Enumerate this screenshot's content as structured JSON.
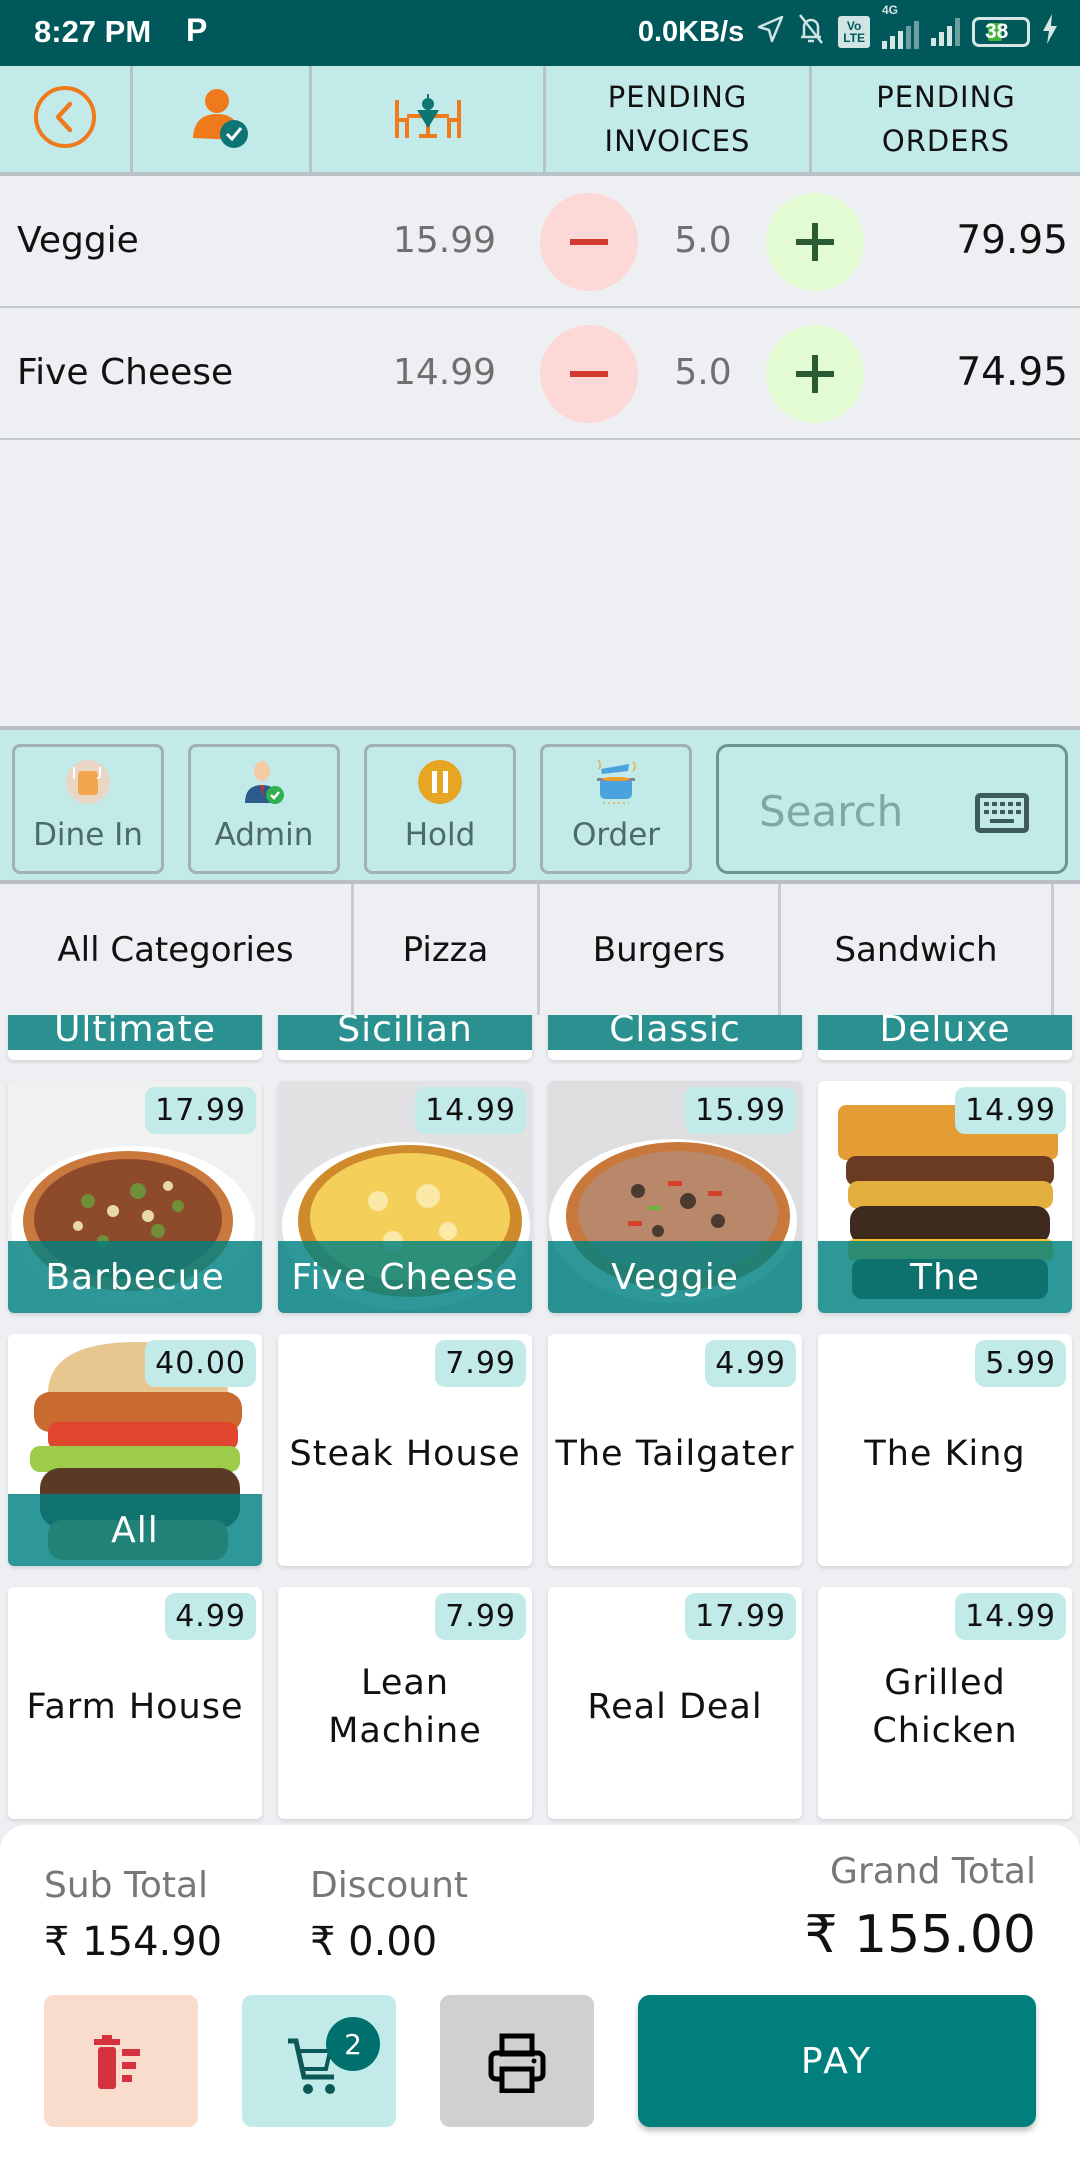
{
  "status_bar": {
    "time": "8:27 PM",
    "app_notification": "P",
    "net_speed": "0.0KB/s",
    "volte": "Vo LTE",
    "network": "4G",
    "battery": "38"
  },
  "header": {
    "back_icon": "back-circle-icon",
    "user_icon": "user-verified-icon",
    "table_icon": "dining-table-icon",
    "pending_invoices": "PENDING\nINVOICES",
    "pending_invoices_line1": "PENDING",
    "pending_invoices_line2": "INVOICES",
    "pending_orders_line1": "PENDING",
    "pending_orders_line2": "ORDERS"
  },
  "order_items": [
    {
      "name": "Veggie",
      "price": "15.99",
      "qty": "5.0",
      "total": "79.95"
    },
    {
      "name": "Five Cheese",
      "price": "14.99",
      "qty": "5.0",
      "total": "74.95"
    }
  ],
  "actions": {
    "dine_in": "Dine In",
    "admin": "Admin",
    "hold": "Hold",
    "order": "Order",
    "search_placeholder": "Search"
  },
  "categories": [
    "All Categories",
    "Pizza",
    "Burgers",
    "Sandwich",
    ""
  ],
  "products": {
    "partial_row": [
      "Ultimate",
      "Sicilian",
      "Classic",
      "Deluxe"
    ],
    "rows": [
      [
        {
          "name": "Barbecue",
          "price": "17.99",
          "image": "pizza-bbq"
        },
        {
          "name": "Five Cheese",
          "price": "14.99",
          "image": "pizza-cheese"
        },
        {
          "name": "Veggie",
          "price": "15.99",
          "image": "pizza-veggie"
        },
        {
          "name": "The",
          "price": "14.99",
          "image": "burger-stack"
        }
      ],
      [
        {
          "name": "All",
          "price": "40.00",
          "image": "burger-chicken"
        },
        {
          "name": "Steak House",
          "price": "7.99",
          "image": ""
        },
        {
          "name": "The Tailgater",
          "price": "4.99",
          "image": ""
        },
        {
          "name": "The King",
          "price": "5.99",
          "image": ""
        }
      ],
      [
        {
          "name": "Farm House",
          "price": "4.99",
          "image": ""
        },
        {
          "name": "Lean Machine",
          "price": "7.99",
          "image": ""
        },
        {
          "name": "Real Deal",
          "price": "17.99",
          "image": ""
        },
        {
          "name": "Grilled Chicken",
          "price": "14.99",
          "image": ""
        }
      ]
    ]
  },
  "summary": {
    "sub_total_label": "Sub Total",
    "sub_total": "₹ 154.90",
    "discount_label": "Discount",
    "discount": "₹ 0.00",
    "grand_total_label": "Grand Total",
    "grand_total": "₹ 155.00"
  },
  "footer": {
    "cart_count": "2",
    "pay_label": "PAY"
  },
  "colors": {
    "status_bar": "#00585a",
    "header_bg": "#c2eae8",
    "accent": "#007f7d",
    "orange": "#ee7a1c",
    "minus_bg": "#fcd8d6",
    "plus_bg": "#e2fbd3",
    "delete_bg": "#f9dccc",
    "print_bg": "#d0d0d0"
  }
}
